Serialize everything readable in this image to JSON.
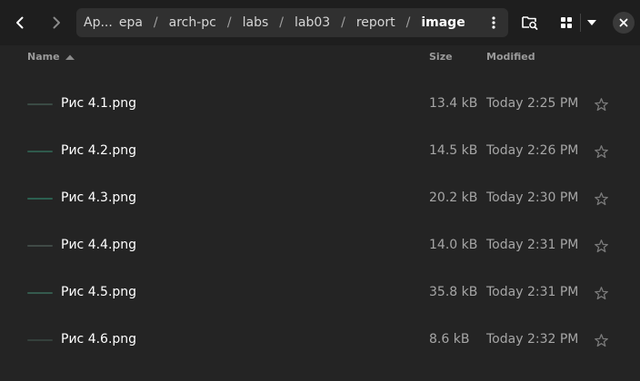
{
  "header": {
    "back_icon": "chevron-left-icon",
    "forward_icon": "chevron-right-icon",
    "breadcrumbs": [
      "Ар...",
      "ера",
      "arch-pc",
      "labs",
      "lab03",
      "report",
      "image"
    ],
    "path_menu_icon": "vertical-ellipsis-icon",
    "search_icon": "folder-search-icon",
    "view_icon": "grid-view-icon",
    "view_menu_icon": "triangle-down-icon",
    "close_icon": "close-icon"
  },
  "columns": {
    "name": "Name",
    "size": "Size",
    "modified": "Modified"
  },
  "files": [
    {
      "name": "Рис 4.1.png",
      "size": "13.4 kB",
      "modified": "Today 2:25 PM",
      "thumb_color": "#3a4a44"
    },
    {
      "name": "Рис 4.2.png",
      "size": "14.5 kB",
      "modified": "Today 2:26 PM",
      "thumb_color": "#2f5a4c"
    },
    {
      "name": "Рис 4.3.png",
      "size": "20.2 kB",
      "modified": "Today 2:30 PM",
      "thumb_color": "#2c6050"
    },
    {
      "name": "Рис 4.4.png",
      "size": "14.0 kB",
      "modified": "Today 2:31 PM",
      "thumb_color": "#404a46"
    },
    {
      "name": "Рис 4.5.png",
      "size": "35.8 kB",
      "modified": "Today 2:31 PM",
      "thumb_color": "#355a4e"
    },
    {
      "name": "Рис 4.6.png",
      "size": "8.6 kB",
      "modified": "Today 2:32 PM",
      "thumb_color": "#34403c"
    }
  ],
  "colors": {
    "background": "#242424",
    "headerbar": "#1e1e1e",
    "pathbar": "#303030",
    "secondary_text": "#a6a6a6"
  }
}
